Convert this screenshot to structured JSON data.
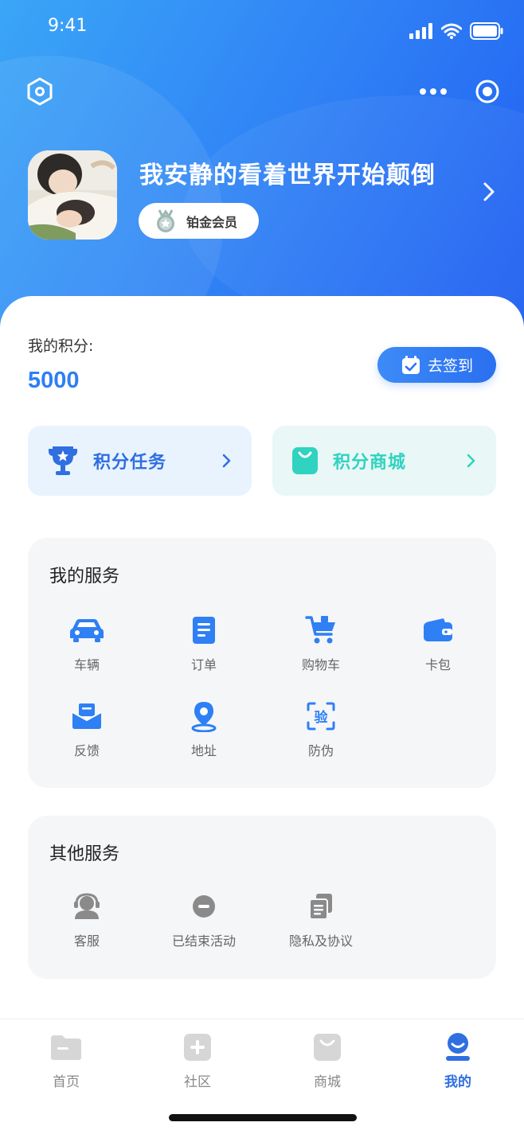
{
  "status": {
    "time": "9:41"
  },
  "profile": {
    "name": "我安静的看着世界开始颠倒",
    "membership": "铂金会员"
  },
  "points": {
    "label": "我的积分:",
    "value": "5000",
    "checkin_label": "去签到"
  },
  "cards": [
    {
      "label": "积分任务",
      "icon": "trophy-icon"
    },
    {
      "label": "积分商城",
      "icon": "shopping-bag-icon"
    }
  ],
  "my_services": {
    "title": "我的服务",
    "items": [
      {
        "label": "车辆",
        "icon": "car-icon"
      },
      {
        "label": "订单",
        "icon": "document-icon"
      },
      {
        "label": "购物车",
        "icon": "cart-icon"
      },
      {
        "label": "卡包",
        "icon": "wallet-icon"
      },
      {
        "label": "反馈",
        "icon": "envelope-icon"
      },
      {
        "label": "地址",
        "icon": "location-pin-icon"
      },
      {
        "label": "防伪",
        "icon": "verify-scan-icon"
      }
    ]
  },
  "other_services": {
    "title": "其他服务",
    "items": [
      {
        "label": "客服",
        "icon": "headset-icon"
      },
      {
        "label": "已结束活动",
        "icon": "minus-circle-icon"
      },
      {
        "label": "隐私及协议",
        "icon": "documents-icon"
      }
    ]
  },
  "tabbar": {
    "items": [
      {
        "label": "首页",
        "icon": "folder-icon",
        "active": false
      },
      {
        "label": "社区",
        "icon": "plus-square-icon",
        "active": false
      },
      {
        "label": "商城",
        "icon": "bag-icon",
        "active": false
      },
      {
        "label": "我的",
        "icon": "profile-icon",
        "active": true
      }
    ]
  },
  "colors": {
    "primary": "#2f7ff5",
    "teal": "#2fd3c0",
    "gray_icon": "#8a8a8a"
  }
}
